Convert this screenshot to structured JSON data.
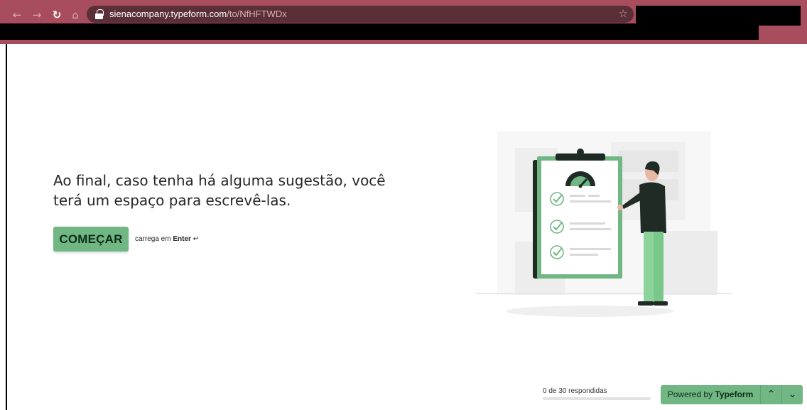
{
  "browser": {
    "url_host": "sienacompany.typeform.com",
    "url_path": "/to/NfHFTWDx",
    "back_icon": "arrow-left-icon",
    "forward_icon": "arrow-right-icon",
    "reload_icon": "reload-icon",
    "home_icon": "home-icon",
    "bookmark_icon": "star-icon",
    "chrome_color": "#a84d5d"
  },
  "welcome": {
    "message": "Ao final, caso tenha há alguma sugestão, você terá um espaço para escrevê-las.",
    "start_label": "COMEÇAR",
    "hint_prefix": "carrega em",
    "hint_key": "Enter",
    "hint_icon": "enter-key-icon"
  },
  "footer": {
    "progress_text": "0 de 30 respondidas",
    "progress_fraction": 0,
    "powered_prefix": "Powered by",
    "powered_brand": "Typeform",
    "up_icon": "chevron-up-icon",
    "down_icon": "chevron-down-icon"
  },
  "theme": {
    "accent": "#70b783",
    "text": "#262626"
  }
}
